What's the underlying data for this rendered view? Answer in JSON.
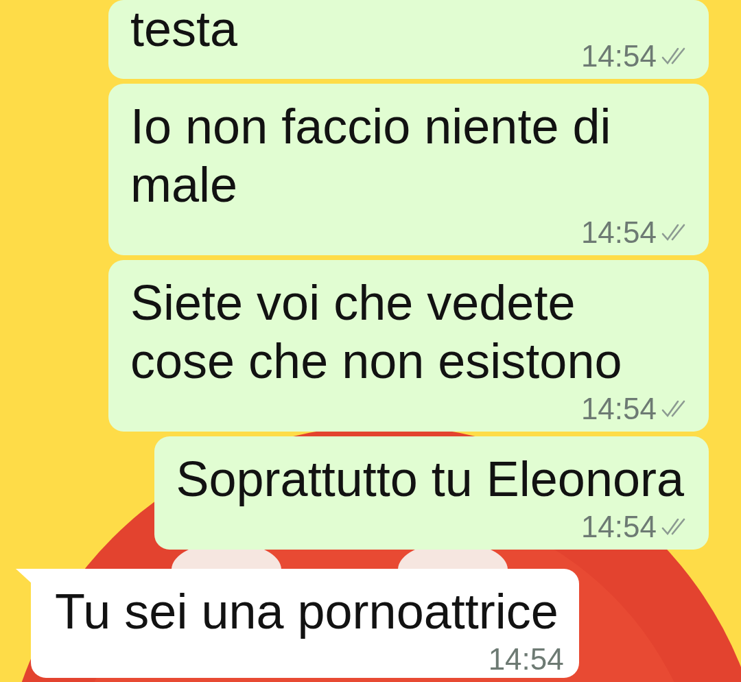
{
  "messages": [
    {
      "kind": "outgoing",
      "text": "testa",
      "time": "14:54",
      "read": false,
      "cut_top": true
    },
    {
      "kind": "outgoing",
      "text": "Io non faccio niente di male",
      "time": "14:54",
      "read": false,
      "cut_top": false
    },
    {
      "kind": "outgoing",
      "text": "Siete voi che vedete cose che non esistono",
      "time": "14:54",
      "read": false,
      "cut_top": false
    },
    {
      "kind": "outgoing",
      "text": "Soprattutto tu Eleonora",
      "time": "14:54",
      "read": false,
      "cut_top": false
    },
    {
      "kind": "incoming",
      "text": "Tu sei una pornoattrice",
      "time": "14:54",
      "cut_top": false
    }
  ]
}
